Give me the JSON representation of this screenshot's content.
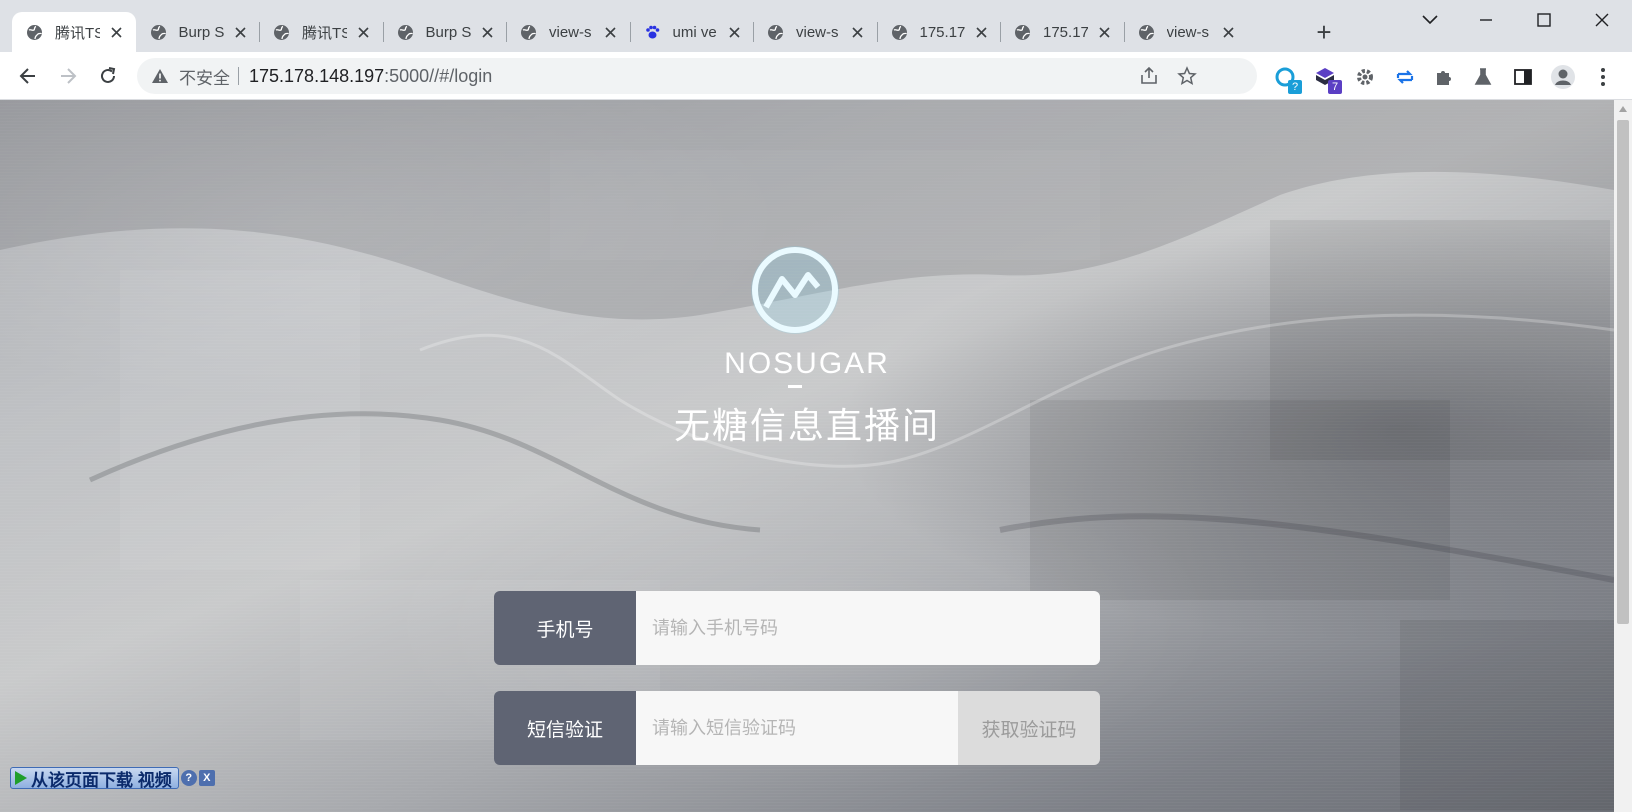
{
  "browser": {
    "tabs": [
      {
        "title": "腾讯TS",
        "icon": "globe-icon",
        "active": true
      },
      {
        "title": "Burp S",
        "icon": "globe-icon"
      },
      {
        "title": "腾讯TS",
        "icon": "globe-icon"
      },
      {
        "title": "Burp S",
        "icon": "globe-icon"
      },
      {
        "title": "view-s",
        "icon": "globe-icon"
      },
      {
        "title": "umi ve",
        "icon": "baidu-paw-icon"
      },
      {
        "title": "view-s",
        "icon": "globe-icon"
      },
      {
        "title": "175.17",
        "icon": "globe-icon"
      },
      {
        "title": "175.17",
        "icon": "globe-icon"
      },
      {
        "title": "view-s",
        "icon": "globe-icon"
      }
    ],
    "address": {
      "security_label": "不安全",
      "host": "175.178.148.197",
      "path": ":5000//#/login"
    },
    "extensions": [
      {
        "name": "extension-refresh-icon",
        "badge": "?",
        "color": "#1a9ed8"
      },
      {
        "name": "extension-cube-icon",
        "badge": "7",
        "color": "#5b3fc4"
      },
      {
        "name": "extension-gear-icon",
        "badge": "",
        "color": "#5f6368"
      },
      {
        "name": "extension-sync-icon",
        "badge": "",
        "color": "#1a73e8"
      },
      {
        "name": "extensions-puzzle-icon",
        "badge": "",
        "color": "#5f6368"
      }
    ]
  },
  "page": {
    "brand_en": "NOSUGAR",
    "brand_cn": "无糖信息直播间",
    "phone_label": "手机号",
    "phone_placeholder": "请输入手机号码",
    "sms_label": "短信验证",
    "sms_placeholder": "请输入短信验证码",
    "sms_button": "获取验证码"
  },
  "download_bar": {
    "label": "从该页面下载 视频",
    "help": "?",
    "close": "X"
  }
}
